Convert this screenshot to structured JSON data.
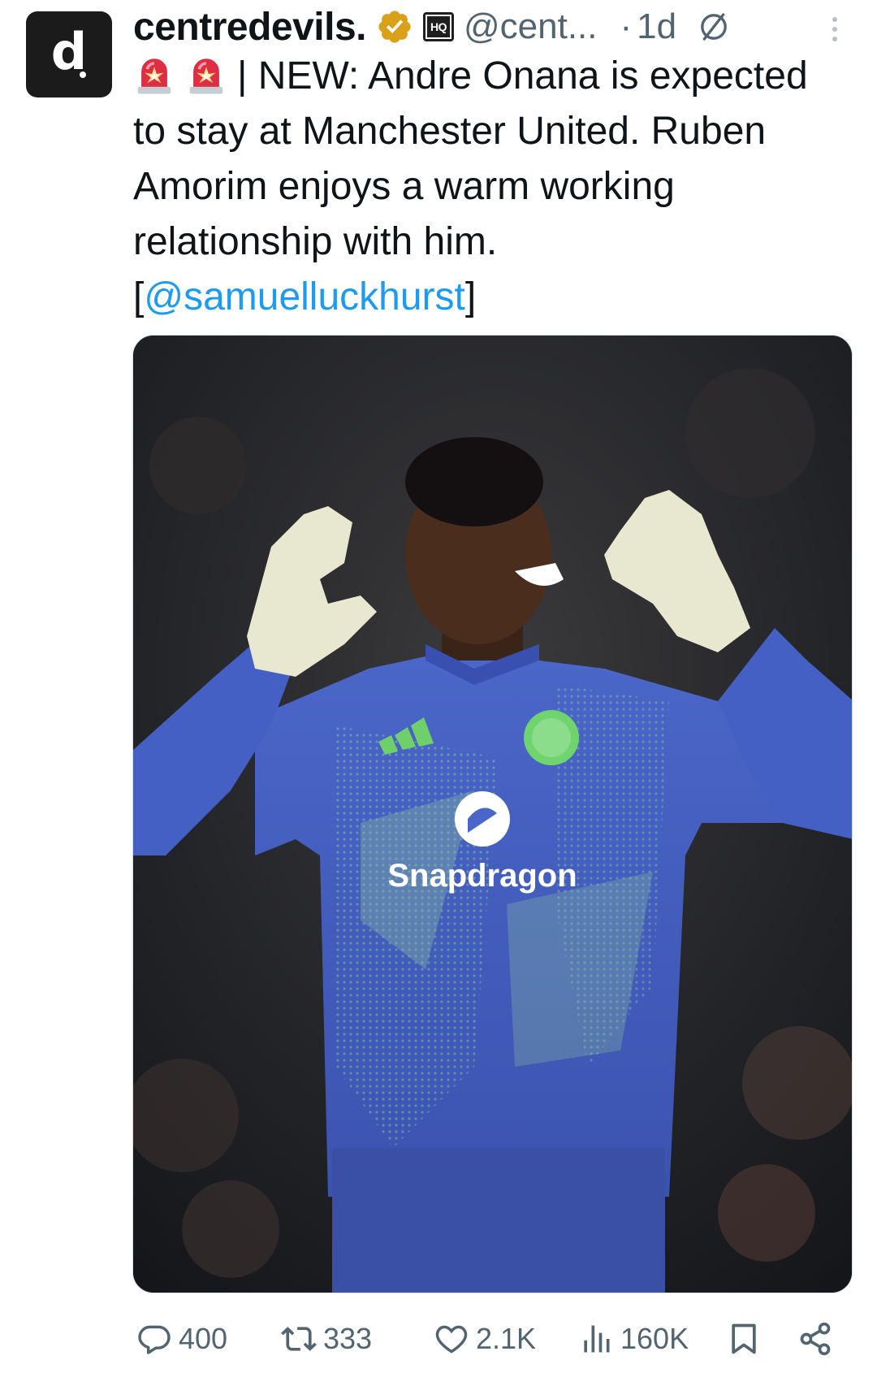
{
  "account": {
    "display_name": "centredevils.",
    "avatar_letter": "d",
    "handle": "@cent...",
    "separator": "·",
    "time": "1d",
    "affiliate_badge": "HQ",
    "verified_color": "#d9a11a"
  },
  "tweet": {
    "line1_text": "| NEW: Andre Onana is expected",
    "line2_text": "to stay at Manchester United. Ruben",
    "line3_text": "Amorim enjoys a warm working",
    "line4_text": "relationship with him.",
    "source_open": "[",
    "source_link": "@samuelluckhurst",
    "source_close": "]",
    "leading_emoji": "police-car-light-icon"
  },
  "media": {
    "sponsor_text": "Snapdragon"
  },
  "actions": {
    "replies": "400",
    "reposts": "333",
    "likes": "2.1K",
    "views": "160K"
  },
  "colors": {
    "link": "#1d9bf0",
    "muted": "#536471",
    "text": "#0f1419"
  }
}
